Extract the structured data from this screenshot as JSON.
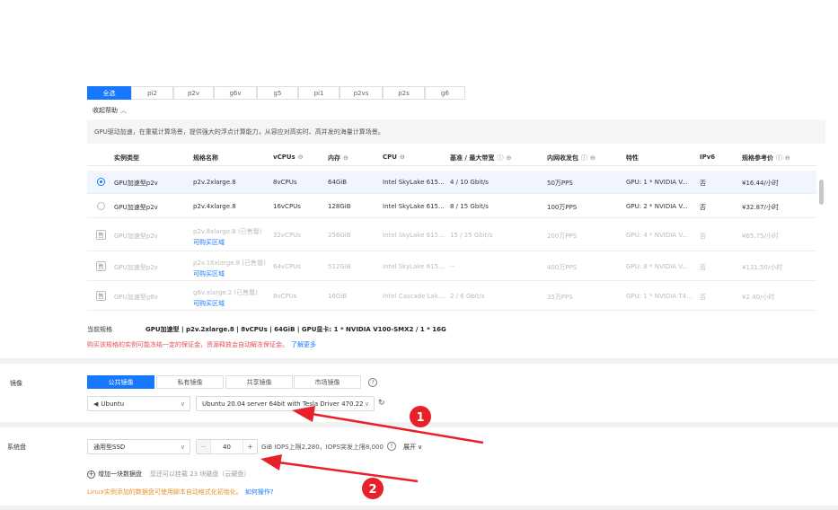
{
  "instance_types": [
    {
      "label": "全选",
      "active": true
    },
    {
      "label": "pi2",
      "active": false
    },
    {
      "label": "p2v",
      "active": false
    },
    {
      "label": "g6v",
      "active": false
    },
    {
      "label": "g5",
      "active": false
    },
    {
      "label": "pi1",
      "active": false
    },
    {
      "label": "p2vs",
      "active": false
    },
    {
      "label": "p2s",
      "active": false
    },
    {
      "label": "g6",
      "active": false
    }
  ],
  "fold_help": "收起帮助",
  "description": "GPU驱动加速，在重载计算场景，提供强大的浮点计算能力，从容应对高实时、高并发的海量计算场景。",
  "table": {
    "headers": [
      "实例类型",
      "规格名称",
      "vCPUs",
      "内存",
      "CPU",
      "基准 / 最大带宽",
      "内网收发包",
      "特性",
      "IPv6",
      "规格参考价"
    ],
    "rows": [
      {
        "type": "GPU加速型p2v",
        "spec": "p2v.2xlarge.8",
        "spec_note": "",
        "vcpus": "8vCPUs",
        "memory": "64GiB",
        "cpu": "Intel SkyLake 615...",
        "bandwidth": "4 / 10 Gbit/s",
        "pps": "50万PPS",
        "feature": "GPU: 1 * NVIDIA V...",
        "ipv6": "否",
        "price": "¥16.44/小时",
        "state": "selected"
      },
      {
        "type": "GPU加速型p2v",
        "spec": "p2v.4xlarge.8",
        "spec_note": "",
        "vcpus": "16vCPUs",
        "memory": "128GiB",
        "cpu": "Intel SkyLake 615...",
        "bandwidth": "8 / 15 Gbit/s",
        "pps": "100万PPS",
        "feature": "GPU: 2 * NVIDIA V...",
        "ipv6": "否",
        "price": "¥32.87/小时",
        "state": "available"
      },
      {
        "type": "GPU加速型p2v",
        "spec": "p2v.8xlarge.8 (已售罄)",
        "spec_note": "可购买区域",
        "vcpus": "32vCPUs",
        "memory": "256GiB",
        "cpu": "Intel SkyLake 615...",
        "bandwidth": "15 / 25 Gbit/s",
        "pps": "200万PPS",
        "feature": "GPU: 4 * NVIDIA V...",
        "ipv6": "否",
        "price": "¥65.75/小时",
        "state": "soldout"
      },
      {
        "type": "GPU加速型p2v",
        "spec": "p2v.16xlarge.8 (已售罄)",
        "spec_note": "可购买区域",
        "vcpus": "64vCPUs",
        "memory": "512GiB",
        "cpu": "Intel SkyLake 615...",
        "bandwidth": "--",
        "pps": "400万PPS",
        "feature": "GPU: 8 * NVIDIA V...",
        "ipv6": "否",
        "price": "¥131.50/小时",
        "state": "soldout"
      },
      {
        "type": "GPU加速型g6v",
        "spec": "g6v.xlarge.2 (已售罄)",
        "spec_note": "可购买区域",
        "vcpus": "8vCPUs",
        "memory": "16GiB",
        "cpu": "Intel Cascade Lak...",
        "bandwidth": "2 / 6 Gbit/s",
        "pps": "35万PPS",
        "feature": "GPU: 1 * NVIDIA T4...",
        "ipv6": "否",
        "price": "¥2.40/小时",
        "state": "soldout"
      }
    ]
  },
  "current_spec": {
    "label": "当前规格",
    "value": "GPU加速型 | p2v.2xlarge.8 | 8vCPUs | 64GiB | GPU显卡: 1 * NVIDIA V100-SMX2 / 1 * 16G"
  },
  "warning": {
    "text": "购买该规格的实例可能冻结一定的保证金，资源释放会自动解冻保证金。",
    "link": "了解更多"
  },
  "image": {
    "label": "镜像",
    "tabs": [
      {
        "label": "公共镜像",
        "active": true
      },
      {
        "label": "私有镜像",
        "active": false
      },
      {
        "label": "共享镜像",
        "active": false
      },
      {
        "label": "市场镜像",
        "active": false
      }
    ],
    "os": "Ubuntu",
    "version": "Ubuntu 20.04 server 64bit with Tesla Driver 470.223.02 a"
  },
  "system_disk": {
    "label": "系统盘",
    "type": "通用型SSD",
    "size": "40",
    "unit_iops": "GiB IOPS上限2,280，IOPS突发上限8,000",
    "expand": "展开"
  },
  "add_disk": {
    "label": "增加一块数据盘",
    "hint": "您还可以挂载 23 块磁盘（云硬盘）"
  },
  "linux_tip": {
    "text": "Linux实例添加的数据盘可使用脚本自动格式化初始化。",
    "link": "如何操作?"
  },
  "annotations": [
    "1",
    "2"
  ],
  "colors": {
    "primary": "#1677ff",
    "annotation": "#e8202a",
    "warning": "#e34d59",
    "tip": "#e8912d"
  }
}
